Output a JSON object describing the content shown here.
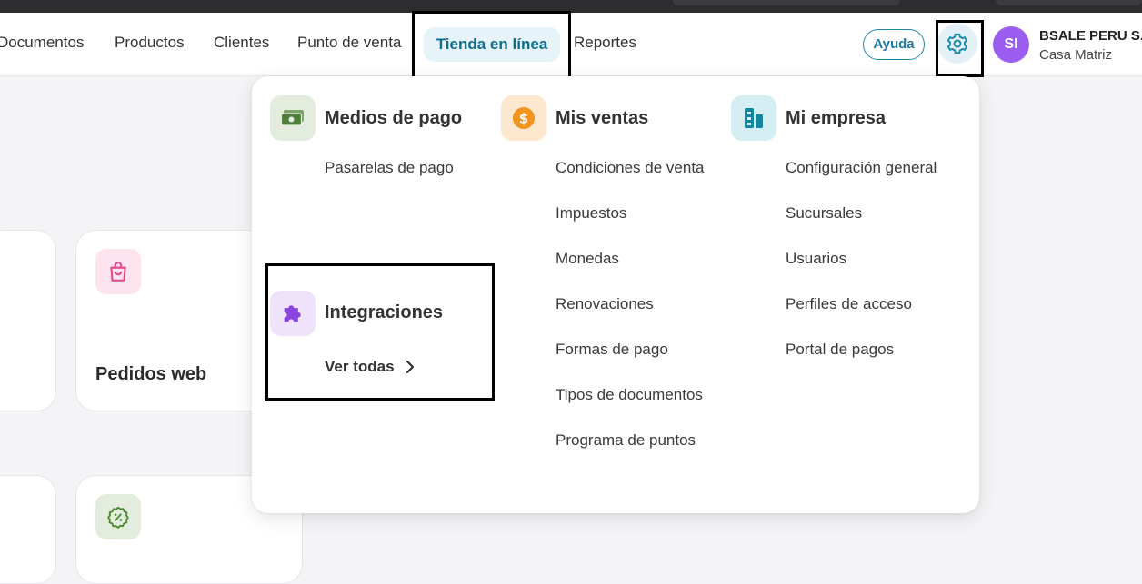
{
  "nav": {
    "items": [
      "Documentos",
      "Productos",
      "Clientes",
      "Punto de venta",
      "Tienda en línea",
      "Reportes"
    ],
    "help_label": "Ayuda",
    "icons": {
      "settings": "gear-icon"
    }
  },
  "user": {
    "initials": "SI",
    "company": "BSALE PERU S...",
    "branch": "Casa Matriz",
    "avatar_color": "#9b5cf0"
  },
  "background_cards": {
    "pedidos_title": "Pedidos web"
  },
  "menu": {
    "payments": {
      "title": "Medios de pago",
      "links": [
        "Pasarelas de pago"
      ]
    },
    "sales": {
      "title": "Mis ventas",
      "links": [
        "Condiciones de venta",
        "Impuestos",
        "Monedas",
        "Renovaciones",
        "Formas de pago",
        "Tipos de documentos",
        "Programa de puntos"
      ]
    },
    "company": {
      "title": "Mi empresa",
      "links": [
        "Configuración general",
        "Sucursales",
        "Usuarios",
        "Perfiles de acceso",
        "Portal de pagos"
      ]
    },
    "integrations": {
      "title": "Integraciones",
      "see_all": "Ver todas"
    }
  },
  "colors": {
    "accent": "#0e6e8c",
    "active_tab_bg": "#e6f3f8",
    "payments_icon_bg": "#e3ecdd",
    "sales_icon_bg": "#fde8cf",
    "company_icon_bg": "#d4eef3",
    "integrations_icon_bg": "#efe2fb"
  }
}
